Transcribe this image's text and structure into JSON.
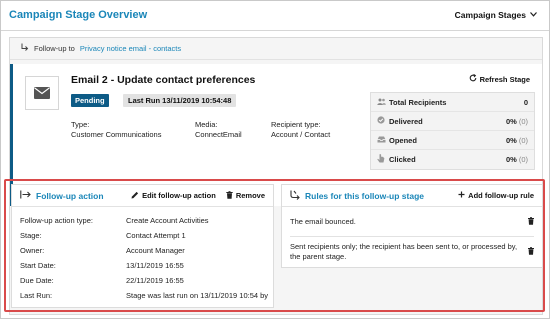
{
  "header": {
    "title": "Campaign Stage Overview",
    "stages_label": "Campaign Stages"
  },
  "followup_bar": {
    "prefix": "Follow-up to",
    "link": "Privacy notice email - contacts"
  },
  "email": {
    "title": "Email 2 - Update contact preferences",
    "status": "Pending",
    "last_run": "Last Run 13/11/2019 10:54:48",
    "type_label": "Type:",
    "type_value": "Customer Communications",
    "media_label": "Media:",
    "media_value": "ConnectEmail",
    "recipient_label": "Recipient type:",
    "recipient_value": "Account / Contact",
    "refresh_label": "Refresh Stage"
  },
  "stats": [
    {
      "icon": "users-icon",
      "label": "Total Recipients",
      "value": "0",
      "sub": ""
    },
    {
      "icon": "check-icon",
      "label": "Delivered",
      "value": "0%",
      "sub": "(0)"
    },
    {
      "icon": "inbox-icon",
      "label": "Opened",
      "value": "0%",
      "sub": "(0)"
    },
    {
      "icon": "cursor-icon",
      "label": "Clicked",
      "value": "0%",
      "sub": "(0)"
    }
  ],
  "followup_action": {
    "title": "Follow-up action",
    "edit_label": "Edit follow-up action",
    "remove_label": "Remove",
    "fields": [
      {
        "label": "Follow-up action type:",
        "value": "Create Account Activities"
      },
      {
        "label": "Stage:",
        "value": "Contact Attempt 1"
      },
      {
        "label": "Owner:",
        "value": "Account Manager"
      },
      {
        "label": "Start Date:",
        "value": "13/11/2019 16:55"
      },
      {
        "label": "Due Date:",
        "value": "22/11/2019 16:55"
      },
      {
        "label": "Last Run:",
        "value": "Stage was last run on 13/11/2019 10:54 by"
      }
    ]
  },
  "rules": {
    "title": "Rules for this follow-up stage",
    "add_label": "Add follow-up rule",
    "items": [
      "The email bounced.",
      "Sent recipients only; the recipient has been sent to, or processed by, the parent stage."
    ]
  },
  "colors": {
    "accent": "#1a86b8",
    "status": "#0d5b86",
    "highlight": "#d94a4a"
  }
}
